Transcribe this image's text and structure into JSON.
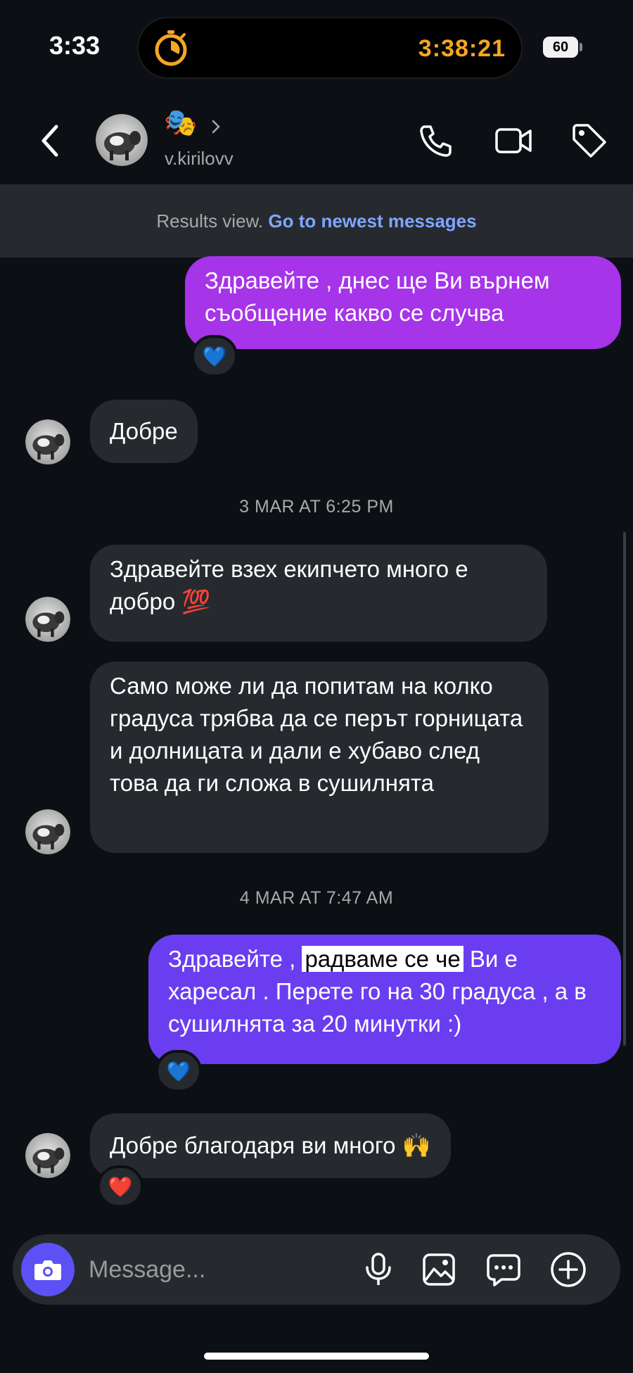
{
  "status_bar": {
    "time": "3:33",
    "timer": "3:38:21",
    "battery": "60",
    "timer_color": "#f5a623"
  },
  "header": {
    "emoji": "🎭",
    "username": "v.kirilovv",
    "icons": [
      "back-icon",
      "phone-icon",
      "video-camera-icon",
      "tag-icon",
      "chevron-right-icon"
    ]
  },
  "results_bar": {
    "text": "Results view.",
    "link": "Go to newest messages"
  },
  "messages": [
    {
      "direction": "outgoing",
      "text": "Здравейте , днес ще Ви върнем съобщение какво се случва",
      "reaction": "💙"
    },
    {
      "direction": "incoming",
      "text": "Добре"
    },
    {
      "type": "date",
      "text": "3 MAR AT 6:25 PM"
    },
    {
      "direction": "incoming",
      "text": "Здравейте взех екипчето много е добро",
      "emoji": "💯"
    },
    {
      "direction": "incoming",
      "text": "Само може ли да попитам на колко градуса трябва да се перът горницата и долницата и дали е хубаво след това да ги сложа в сушилнята"
    },
    {
      "type": "date",
      "text": "4 MAR AT 7:47 AM"
    },
    {
      "direction": "outgoing",
      "text_before": "Здравейте ,",
      "highlight": "радваме се че",
      "text_after": "Ви е харесал . Перете го на 30 градуса , а в сушилнята за 20 минутки :)",
      "reaction": "💙"
    },
    {
      "direction": "incoming",
      "text": "Добре благодаря ви много",
      "emoji": "🙌",
      "reaction": "❤️"
    }
  ],
  "composer": {
    "placeholder": "Message...",
    "icons": [
      "camera-icon",
      "microphone-icon",
      "gallery-icon",
      "sticker-icon",
      "plus-icon"
    ],
    "camera_color": "#5b51f5"
  },
  "colors": {
    "background": "#0c1014",
    "incoming_bubble": "#262a2f",
    "outgoing_bubble_1": "#a634e8",
    "outgoing_bubble_2": "#6a3ef0",
    "link": "#7ea6ff"
  }
}
